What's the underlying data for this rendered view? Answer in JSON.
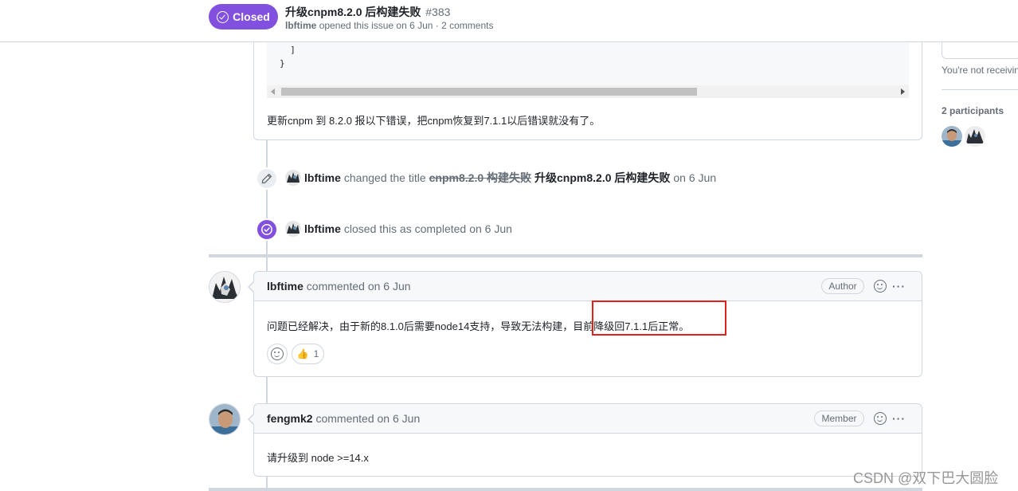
{
  "header": {
    "state_label": "Closed",
    "title": "升级cnpm8.2.0 后构建失败",
    "number": "#383",
    "author": "lbftime",
    "meta_rest": "opened this issue on 6 Jun · 2 comments"
  },
  "first_comment": {
    "code_lines": [
      "  ]",
      "}"
    ],
    "text": "更新cnpm 到 8.2.0 报以下错误，把cnpm恢复到7.1.1以后错误就没有了。"
  },
  "events": [
    {
      "icon": "pencil-icon",
      "actor": "lbftime",
      "action": "changed the title",
      "old_title": "cnpm8.2.0 构建失败",
      "new_title": "升级cnpm8.2.0 后构建失败",
      "time": "on 6 Jun"
    },
    {
      "icon": "check-circle-icon",
      "actor": "lbftime",
      "action": "closed this as completed",
      "time": "on 6 Jun"
    }
  ],
  "comments": [
    {
      "author": "lbftime",
      "action": "commented",
      "time": "on 6 Jun",
      "role": "Author",
      "body": "问题已经解决，由于新的8.1.0后需要node14支持，导致无法构建，目前降级回7.1.1后正常。",
      "reactions": [
        {
          "emoji": "👍",
          "count": "1"
        }
      ]
    },
    {
      "author": "fengmk2",
      "action": "commented",
      "time": "on 6 Jun",
      "role": "Member",
      "body": "请升级到 node >=14.x"
    }
  ],
  "sidebar": {
    "notifications_note": "You're not receivin",
    "participants_heading": "2 participants"
  },
  "watermark": "CSDN @双下巴大圆脸",
  "colors": {
    "closed_purple": "#8250df",
    "border": "#d0d7de",
    "muted_text": "#656d76",
    "highlight_red": "#e0201b"
  }
}
